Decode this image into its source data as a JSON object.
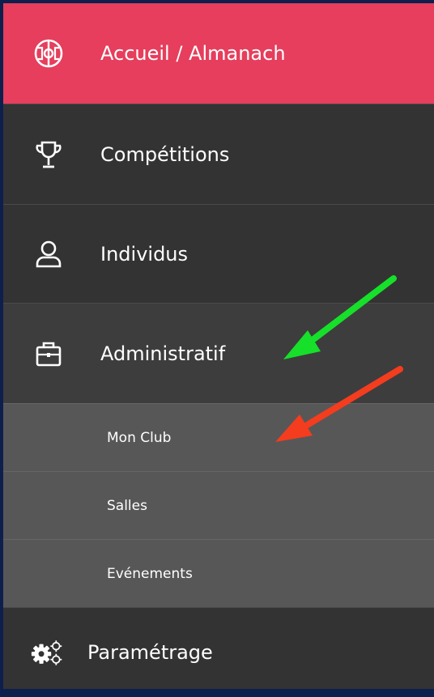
{
  "menu": {
    "items": [
      {
        "label": "Accueil / Almanach",
        "icon": "soccer-field-icon",
        "state": "active"
      },
      {
        "label": "Compétitions",
        "icon": "trophy-icon"
      },
      {
        "label": "Individus",
        "icon": "user-icon"
      },
      {
        "label": "Administratif",
        "icon": "briefcase-icon",
        "state": "expanded"
      }
    ],
    "subitems": [
      {
        "label": "Mon Club"
      },
      {
        "label": "Salles"
      },
      {
        "label": "Evénements"
      }
    ],
    "bottom": {
      "label": "Paramétrage",
      "icon": "gears-icon"
    }
  },
  "colors": {
    "active": "#e63e5c",
    "menu_bg": "#333333",
    "submenu_bg": "#575757",
    "frame": "#0d1f4d",
    "arrow_green": "#16e02a",
    "arrow_red": "#f43c1e"
  },
  "annotations": [
    {
      "icon": "green-arrow-icon",
      "points_to": "Administratif"
    },
    {
      "icon": "red-arrow-icon",
      "points_to": "Mon Club"
    }
  ]
}
